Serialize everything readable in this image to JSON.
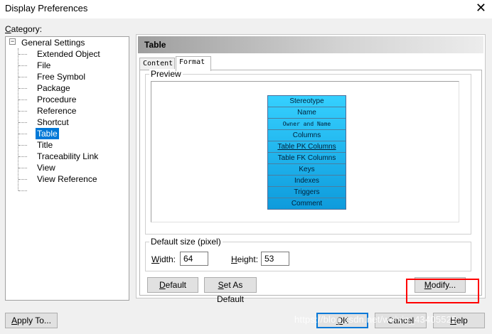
{
  "window": {
    "title": "Display Preferences",
    "close_glyph": "✕"
  },
  "category": {
    "label": "Category:",
    "root": "General Settings",
    "expander_glyph": "−",
    "items": [
      "Extended Object",
      "File",
      "Free Symbol",
      "Package",
      "Procedure",
      "Reference",
      "Shortcut",
      "Table",
      "Title",
      "Traceability Link",
      "View",
      "View Reference"
    ],
    "selected": "Table"
  },
  "panel": {
    "header": "Table",
    "tabs": [
      "Content",
      "Format"
    ],
    "active_tab": "Format",
    "preview_label": "Preview",
    "symbol_rows": [
      "Stereotype",
      "Name",
      "Owner and Name",
      "Columns",
      "Table PK Columns",
      "Table FK Columns",
      "Keys",
      "Indexes",
      "Triggers",
      "Comment"
    ],
    "size_group_label": "Default size (pixel)",
    "width_label": "Width:",
    "width_value": "64",
    "height_label": "Height:",
    "height_value": "53",
    "default_button": "Default",
    "set_as_default_button": "Set As Default",
    "modify_button": "Modify..."
  },
  "footer": {
    "apply_to_button": "Apply To...",
    "ok_button": "OK",
    "cancel_button": "Cancel",
    "help_button": "Help"
  },
  "watermark": "https://blog.csdn.net/weixin_43405525",
  "colors": {
    "selection": "#0078d7",
    "symbol_fill_top": "#35d0ff",
    "symbol_fill_bottom": "#0e9bdc",
    "highlight_box": "#ff0000"
  }
}
